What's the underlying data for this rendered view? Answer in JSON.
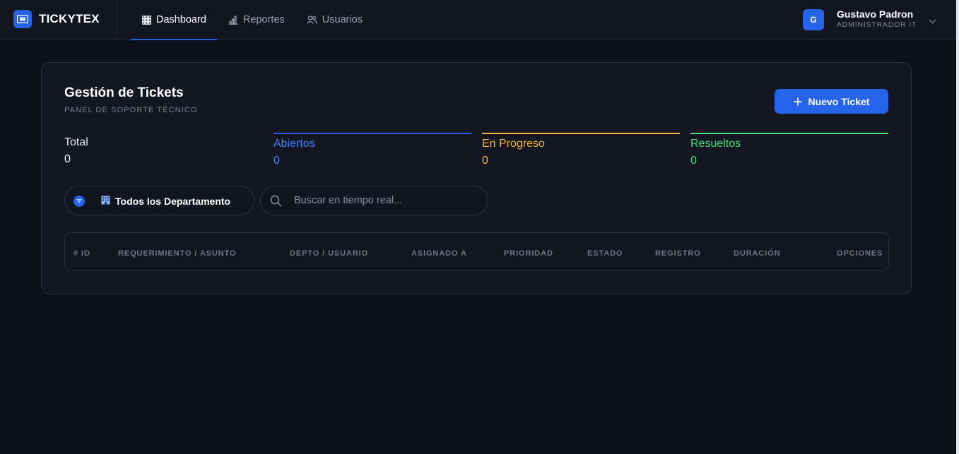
{
  "brand": {
    "name": "TICKYTEX"
  },
  "nav": {
    "items": [
      {
        "label": "Dashboard",
        "icon": "grid-icon",
        "active": true
      },
      {
        "label": "Reportes",
        "icon": "bar-chart-icon",
        "active": false
      },
      {
        "label": "Usuarios",
        "icon": "users-icon",
        "active": false
      }
    ]
  },
  "user": {
    "initial": "G",
    "name": "Gustavo Padron",
    "role": "ADMINISTRADOR IT"
  },
  "panel": {
    "title": "Gestión de Tickets",
    "subtitle": "PANEL DE SOPORTE TÉCNICO",
    "new_button": "Nuevo Ticket"
  },
  "stats": [
    {
      "label": "Total",
      "value": "0",
      "color": "#e5e7eb"
    },
    {
      "label": "Abiertos",
      "value": "0",
      "color": "#3b82f6"
    },
    {
      "label": "En Progreso",
      "value": "0",
      "color": "#f5b53f"
    },
    {
      "label": "Resueltos",
      "value": "0",
      "color": "#4ade80"
    }
  ],
  "filter": {
    "label": "Todos los Departamento"
  },
  "search": {
    "placeholder": "Buscar en tiempo real...",
    "value": ""
  },
  "table": {
    "columns": [
      "# ID",
      "REQUERIMIENTO / ASUNTO",
      "DEPTO / USUARIO",
      "ASIGNADO A",
      "PRIORIDAD",
      "ESTADO",
      "REGISTRO",
      "DURACIÓN",
      "OPCIONES"
    ]
  },
  "colors": {
    "accent": "#2563eb",
    "background": "#0b0f17",
    "panel": "#121722"
  }
}
